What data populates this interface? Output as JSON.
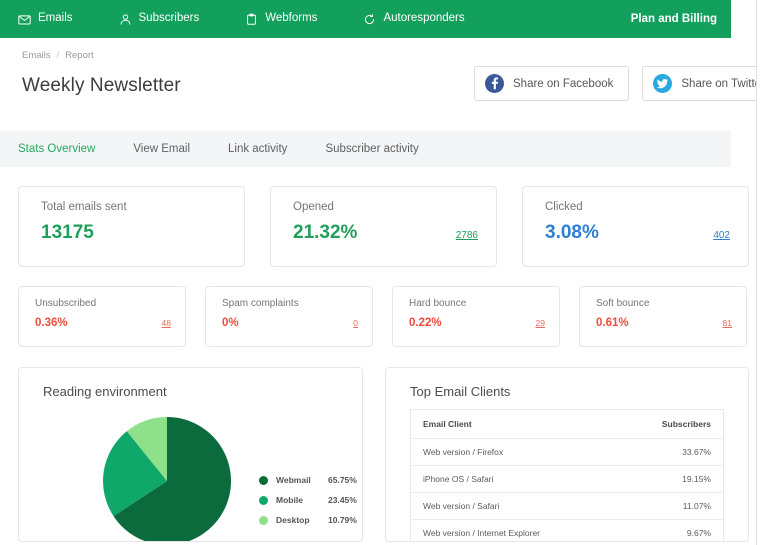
{
  "theme": {
    "header_green": "#13a05c",
    "accent_green": "#20a05a",
    "accent_blue": "#2b7fd4",
    "accent_red": "#ef4b3c",
    "tab_bar_bg": "#f4f5f7"
  },
  "topnav": {
    "items": [
      {
        "label": "Emails",
        "icon": "envelope-icon",
        "active": true
      },
      {
        "label": "Subscribers",
        "icon": "person-icon",
        "active": false
      },
      {
        "label": "Webforms",
        "icon": "clipboard-icon",
        "active": false
      },
      {
        "label": "Autoresponders",
        "icon": "refresh-icon",
        "active": false
      }
    ],
    "plan_billing": "Plan and Billing"
  },
  "breadcrumb": {
    "root": "Emails",
    "separator": "/",
    "current": "Report"
  },
  "header": {
    "title": "Weekly Newsletter",
    "share_facebook": "Share on Facebook",
    "share_twitter": "Share on Twitter"
  },
  "tabs": [
    {
      "label": "Stats Overview",
      "active": true
    },
    {
      "label": "View Email",
      "active": false
    },
    {
      "label": "Link activity",
      "active": false
    },
    {
      "label": "Subscriber activity",
      "active": false
    }
  ],
  "primary_stats": [
    {
      "label": "Total emails sent",
      "value": "13175",
      "value_color": "green",
      "link": ""
    },
    {
      "label": "Opened",
      "value": "21.32%",
      "value_color": "green",
      "link": "2786",
      "link_color": "green"
    },
    {
      "label": "Clicked",
      "value": "3.08%",
      "value_color": "blue",
      "link": "402",
      "link_color": "blue"
    }
  ],
  "secondary_stats": [
    {
      "label": "Unsubscribed",
      "value": "0.36%",
      "link": "48"
    },
    {
      "label": "Spam complaints",
      "value": "0%",
      "link": "0"
    },
    {
      "label": "Hard bounce",
      "value": "0.22%",
      "link": "29"
    },
    {
      "label": "Soft bounce",
      "value": "0.61%",
      "link": "81"
    }
  ],
  "reading_environment": {
    "title": "Reading environment"
  },
  "clients_panel": {
    "title": "Top Email Clients",
    "columns": [
      "Email Client",
      "Subscribers"
    ],
    "rows": [
      {
        "client": "Web version / Firefox",
        "subscribers": "33.67%"
      },
      {
        "client": "iPhone OS / Safari",
        "subscribers": "19.15%"
      },
      {
        "client": "Web version / Safari",
        "subscribers": "11.07%"
      },
      {
        "client": "Web version / Internet Explorer",
        "subscribers": "9.67%"
      }
    ]
  },
  "chart_data": {
    "type": "pie",
    "title": "Reading environment",
    "categories": [
      "Webmail",
      "Mobile",
      "Desktop"
    ],
    "values": [
      65.75,
      23.45,
      10.79
    ],
    "value_labels": [
      "65.75%",
      "23.45%",
      "10.79%"
    ],
    "colors": [
      "#0c6b3d",
      "#10a86a",
      "#8fe08a"
    ],
    "legend_position": "right",
    "start_angle_deg": 0,
    "direction": "clockwise",
    "unit": "percent"
  }
}
